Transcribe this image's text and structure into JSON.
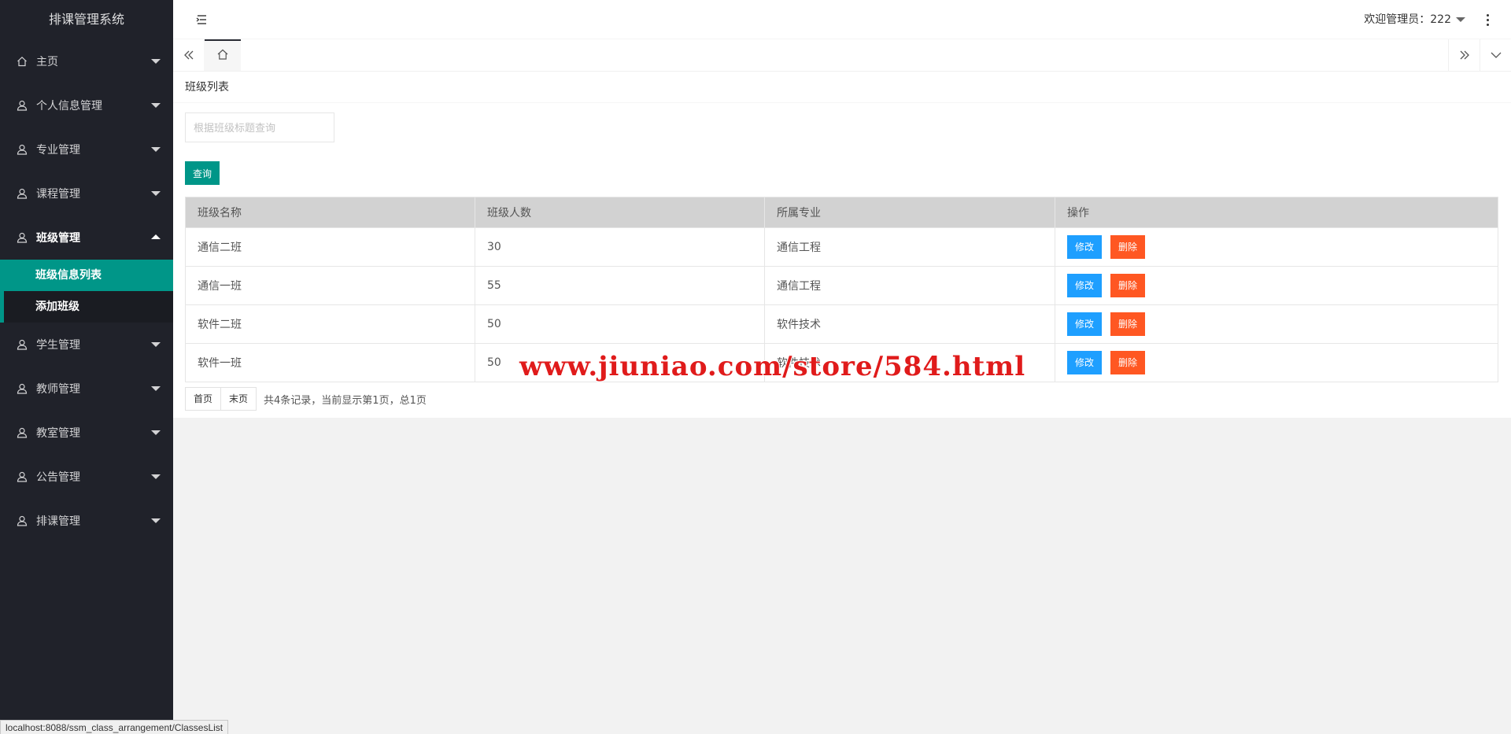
{
  "app": {
    "title": "排课管理系统"
  },
  "sidebar": {
    "items": [
      {
        "label": "主页",
        "icon": "home-icon",
        "open": false
      },
      {
        "label": "个人信息管理",
        "icon": "user-icon",
        "open": false
      },
      {
        "label": "专业管理",
        "icon": "user-icon",
        "open": false
      },
      {
        "label": "课程管理",
        "icon": "user-icon",
        "open": false
      },
      {
        "label": "班级管理",
        "icon": "user-icon",
        "open": true,
        "children": [
          {
            "label": "班级信息列表",
            "active": true
          },
          {
            "label": "添加班级",
            "active": false
          }
        ]
      },
      {
        "label": "学生管理",
        "icon": "user-icon",
        "open": false
      },
      {
        "label": "教师管理",
        "icon": "user-icon",
        "open": false
      },
      {
        "label": "教室管理",
        "icon": "user-icon",
        "open": false
      },
      {
        "label": "公告管理",
        "icon": "user-icon",
        "open": false
      },
      {
        "label": "排课管理",
        "icon": "user-icon",
        "open": false
      }
    ]
  },
  "header": {
    "welcome": "欢迎管理员：222"
  },
  "content": {
    "breadcrumb": "班级列表",
    "search": {
      "placeholder": "根据班级标题查询",
      "value": ""
    },
    "query_label": "查询",
    "table": {
      "headers": [
        "班级名称",
        "班级人数",
        "所属专业",
        "操作"
      ],
      "rows": [
        {
          "name": "通信二班",
          "count": "30",
          "major": "通信工程"
        },
        {
          "name": "通信一班",
          "count": "55",
          "major": "通信工程"
        },
        {
          "name": "软件二班",
          "count": "50",
          "major": "软件技术"
        },
        {
          "name": "软件一班",
          "count": "50",
          "major": "软件技术"
        }
      ],
      "edit_label": "修改",
      "delete_label": "删除"
    },
    "pager": {
      "first": "首页",
      "last": "末页",
      "info": "共4条记录，当前显示第1页，总1页"
    }
  },
  "watermark": "www.jiuniao.com/store/584.html",
  "statusbar": {
    "url": "localhost:8088/ssm_class_arrangement/ClassesList"
  },
  "colors": {
    "sidebar_bg": "#20222a",
    "accent": "#009688",
    "edit": "#1e9fff",
    "delete": "#ff5722"
  }
}
